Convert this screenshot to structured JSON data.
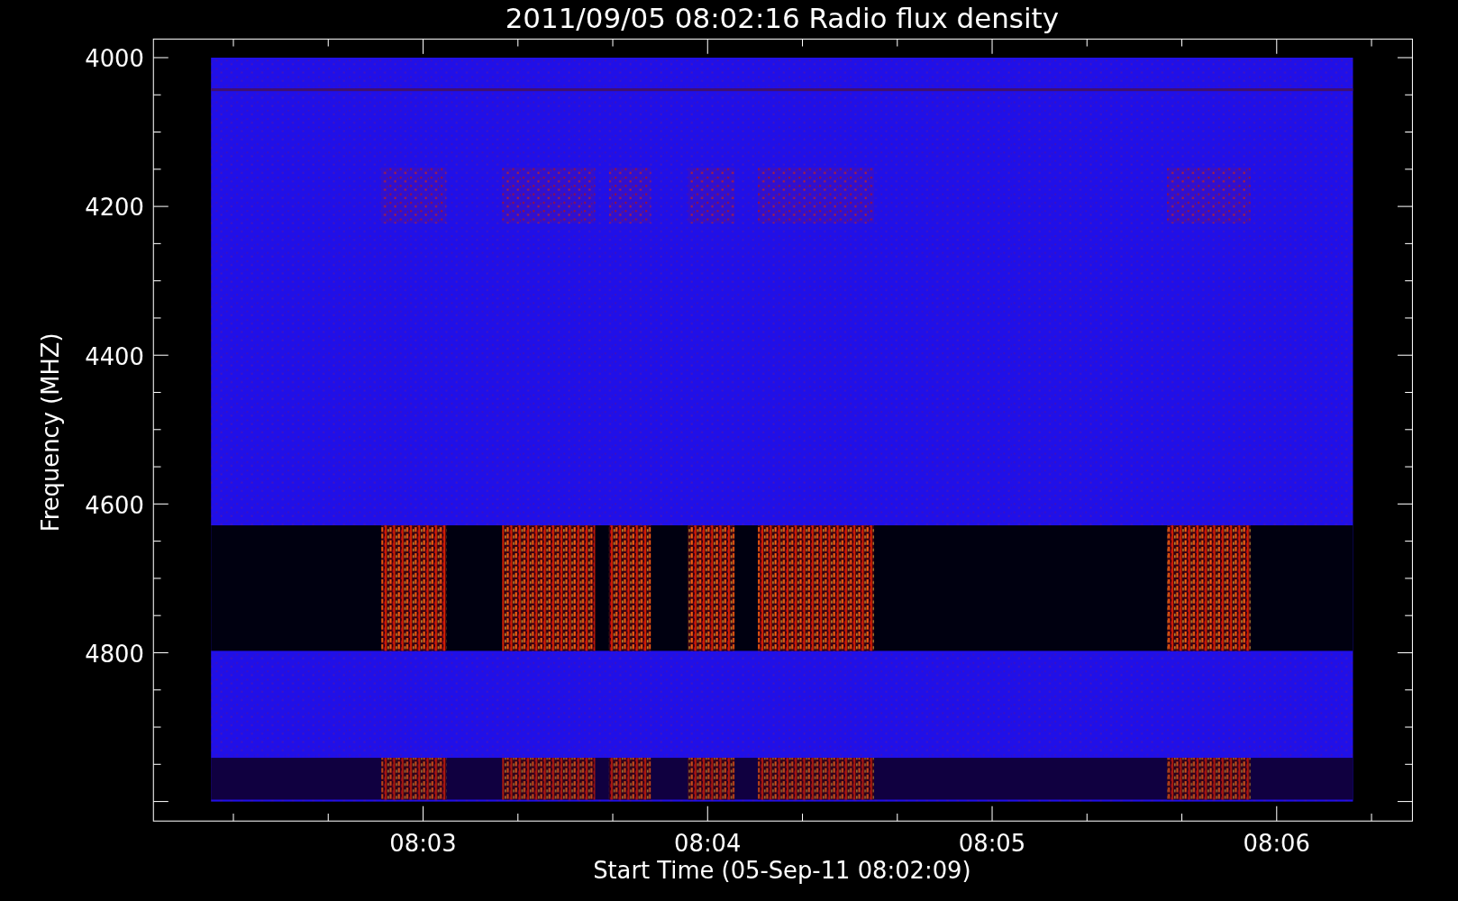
{
  "title": "2011/09/05 08:02:16 Radio flux density",
  "y_axis": {
    "label": "Frequency (MHZ)",
    "ticks": [
      "4000",
      "4200",
      "4400",
      "4600",
      "4800"
    ]
  },
  "x_axis": {
    "label": "Start Time (05-Sep-11 08:02:09)",
    "ticks": [
      "08:03",
      "08:04",
      "08:05",
      "08:06"
    ]
  }
}
